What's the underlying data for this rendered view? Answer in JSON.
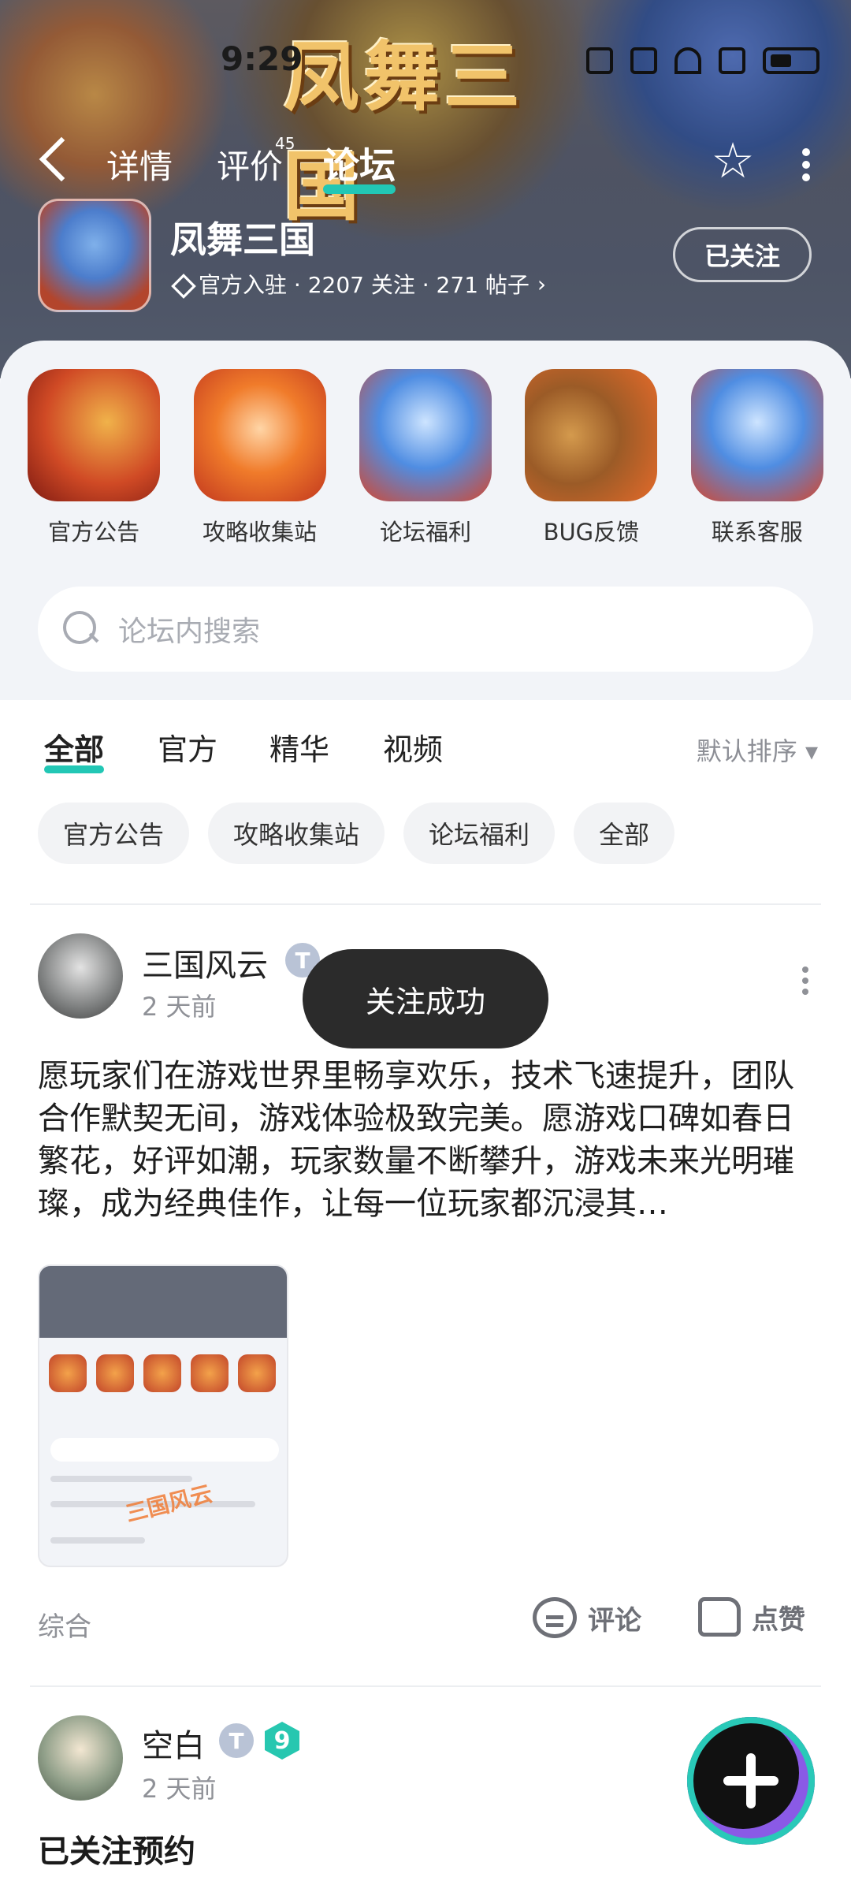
{
  "status_bar": {
    "time": "9:29"
  },
  "header": {
    "logo_text": "凤舞三国",
    "tabs": [
      {
        "label": "详情"
      },
      {
        "label": "评价",
        "count": "45"
      },
      {
        "label": "论坛"
      }
    ]
  },
  "game": {
    "name": "凤舞三国",
    "meta": "官方入驻 · 2207 关注 · 271 帖子",
    "follow_label": "已关注"
  },
  "quick_links": [
    {
      "label": "官方公告"
    },
    {
      "label": "攻略收集站"
    },
    {
      "label": "论坛福利"
    },
    {
      "label": "BUG反馈"
    },
    {
      "label": "联系客服"
    }
  ],
  "search": {
    "placeholder": "论坛内搜索"
  },
  "filter_tabs": [
    {
      "label": "全部"
    },
    {
      "label": "官方"
    },
    {
      "label": "精华"
    },
    {
      "label": "视频"
    }
  ],
  "sort_label": "默认排序",
  "chips": [
    {
      "label": "官方公告"
    },
    {
      "label": "攻略收集站"
    },
    {
      "label": "论坛福利"
    },
    {
      "label": "全部"
    }
  ],
  "posts": [
    {
      "author": "三国风云",
      "time": "2 天前",
      "content": "愿玩家们在游戏世界里畅享欢乐，技术飞速提升，团队合作默契无间，游戏体验极致完美。愿游戏口碑如春日繁花，好评如潮，玩家数量不断攀升，游戏未来光明璀璨，成为经典佳作，让每一位玩家都沉浸其…",
      "category": "综合",
      "comment_label": "评论",
      "like_label": "点赞",
      "thumb_watermark": "三国风云"
    },
    {
      "author": "空白",
      "time": "2 天前",
      "level": "9",
      "title": "已关注预约"
    }
  ],
  "toast": "关注成功",
  "colors": {
    "accent": "#22c7b5",
    "toast_bg": "#2b2b2b"
  }
}
